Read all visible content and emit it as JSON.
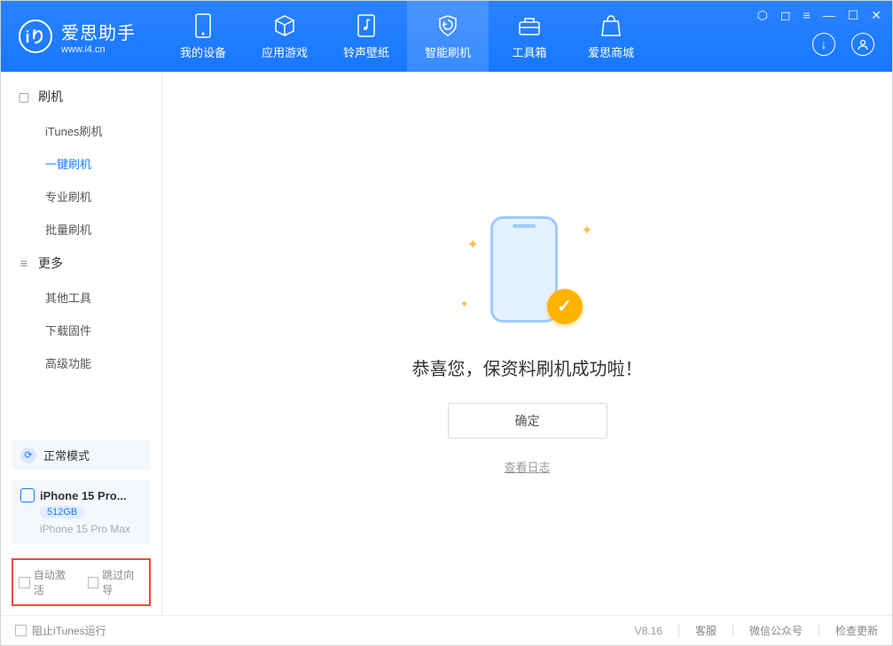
{
  "app": {
    "title": "爱思助手",
    "url": "www.i4.cn"
  },
  "nav": {
    "items": [
      {
        "label": "我的设备",
        "icon": "device"
      },
      {
        "label": "应用游戏",
        "icon": "cube"
      },
      {
        "label": "铃声壁纸",
        "icon": "music"
      },
      {
        "label": "智能刷机",
        "icon": "shield",
        "active": true
      },
      {
        "label": "工具箱",
        "icon": "toolbox"
      },
      {
        "label": "爱思商城",
        "icon": "bag"
      }
    ]
  },
  "sidebar": {
    "groups": [
      {
        "title": "刷机",
        "items": [
          {
            "label": "iTunes刷机"
          },
          {
            "label": "一键刷机",
            "active": true
          },
          {
            "label": "专业刷机"
          },
          {
            "label": "批量刷机"
          }
        ]
      },
      {
        "title": "更多",
        "items": [
          {
            "label": "其他工具"
          },
          {
            "label": "下载固件"
          },
          {
            "label": "高级功能"
          }
        ]
      }
    ],
    "status": {
      "label": "正常模式"
    },
    "device": {
      "name": "iPhone 15 Pro...",
      "storage": "512GB",
      "model": "iPhone 15 Pro Max"
    },
    "options": {
      "auto_activate": "自动激活",
      "skip_wizard": "跳过向导"
    }
  },
  "main": {
    "success_msg": "恭喜您，保资料刷机成功啦！",
    "ok_button": "确定",
    "log_link": "查看日志"
  },
  "footer": {
    "block_itunes": "阻止iTunes运行",
    "version": "V8.16",
    "links": {
      "support": "客服",
      "wechat": "微信公众号",
      "check_update": "检查更新"
    }
  }
}
